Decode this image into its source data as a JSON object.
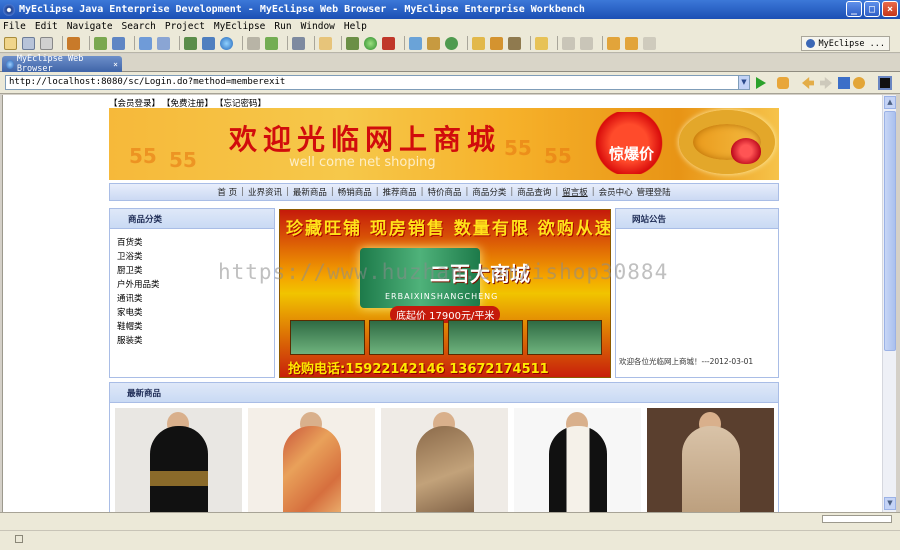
{
  "window": {
    "title": "MyEclipse Java Enterprise Development - MyEclipse Web Browser - MyEclipse Enterprise Workbench"
  },
  "menu": [
    "File",
    "Edit",
    "Navigate",
    "Search",
    "Project",
    "MyEclipse",
    "Run",
    "Window",
    "Help"
  ],
  "perspective": {
    "label": "MyEclipse ..."
  },
  "editor": {
    "tab_label": "MyEclipse Web Browser"
  },
  "browser": {
    "url": "http://localhost:8080/sc/Login.do?method=memberexit"
  },
  "page": {
    "top_links": [
      "【会员登录】",
      "【免费注册】",
      "【忘记密码】"
    ],
    "banner": {
      "title": "欢迎光临网上商城",
      "subtitle": "well come net shoping",
      "badge": "惊爆价"
    },
    "nav": [
      "首 页",
      "业界资讯",
      "最新商品",
      "畅销商品",
      "推荐商品",
      "特价商品",
      "商品分类",
      "商品查询",
      "留言板",
      "会员中心",
      "管理登陆"
    ],
    "categories": {
      "heading": "商品分类",
      "items": [
        "百货类",
        "卫浴类",
        "厨卫类",
        "户外用品类",
        "通讯类",
        "家电类",
        "鞋帽类",
        "服装类"
      ]
    },
    "promo": {
      "headline": "珍藏旺铺 现房销售 数量有限 欲购从速",
      "brand": "二百大商城",
      "brand_en": "ERBAIXINSHANGCHENG",
      "price": "底起价 17900元/平米",
      "phone": "抢购电话:15922142146 13672174511"
    },
    "notice": {
      "heading": "网站公告",
      "text": "欢迎各位光临网上商城！---2012-03-01"
    },
    "watermark": "https://www.huzhan.com/ishop30884",
    "new_products": {
      "heading": "最新商品"
    }
  },
  "colors": {
    "title_bar": "#1b4fb4",
    "chrome": "#ece9d8",
    "panel_header": "#c9daf4",
    "banner_title": "#d10c0c"
  }
}
